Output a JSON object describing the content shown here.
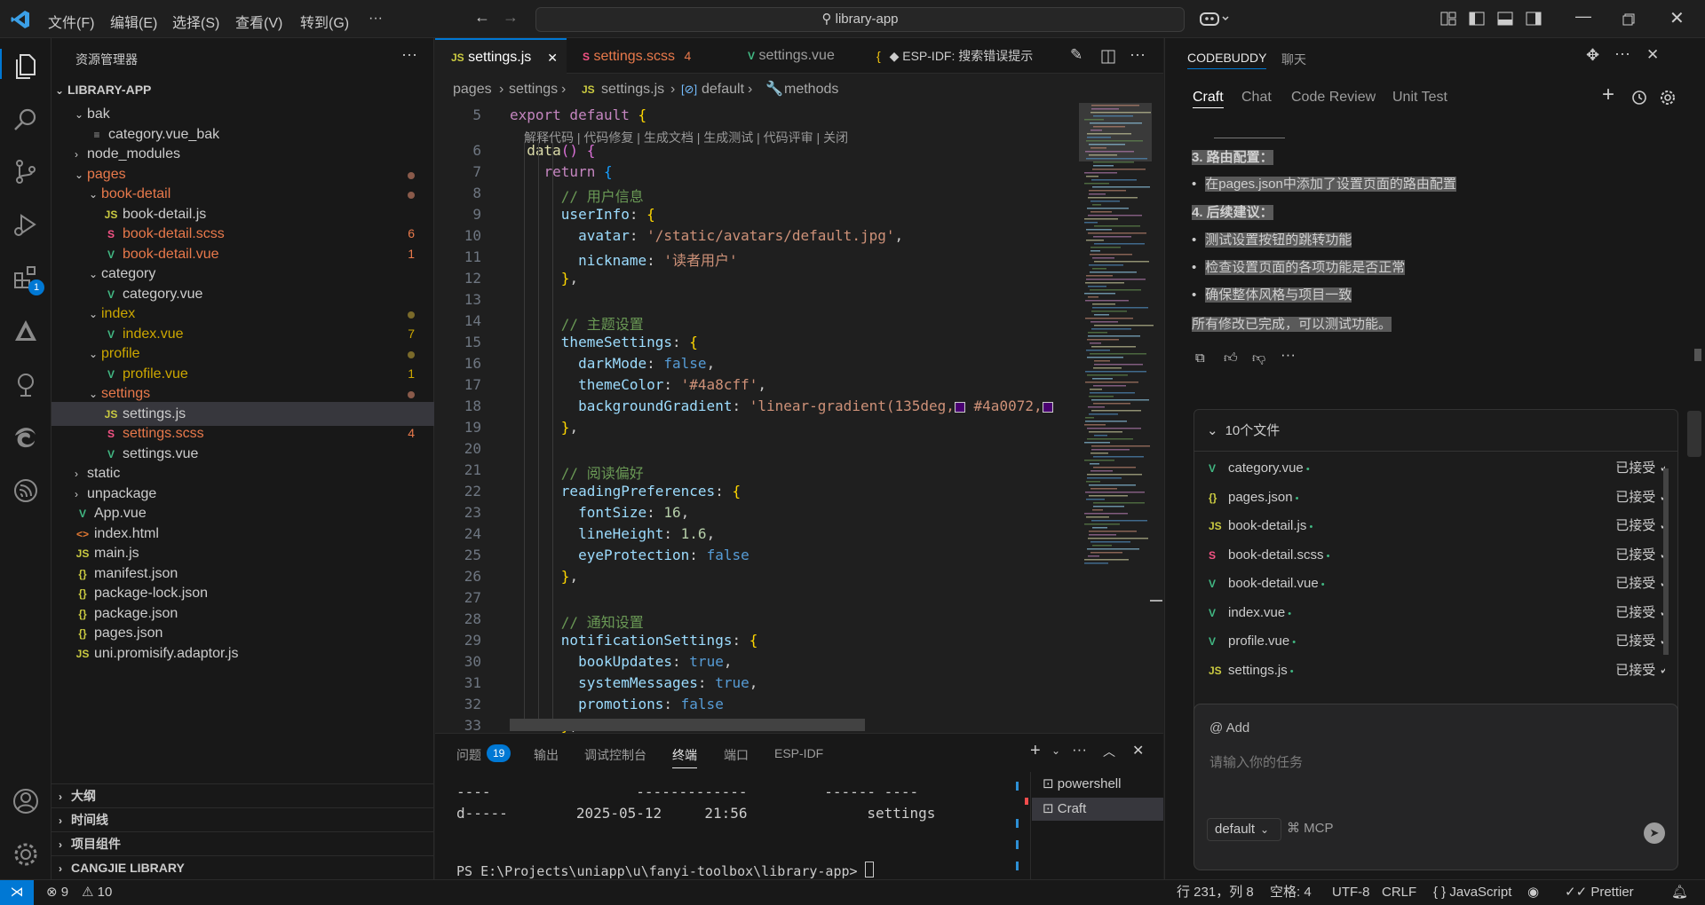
{
  "menu": [
    "文件(F)",
    "编辑(E)",
    "选择(S)",
    "查看(V)",
    "转到(G)",
    "···"
  ],
  "search": {
    "text": "library-app"
  },
  "activity": {
    "extensions_badge": "1"
  },
  "explorer": {
    "title": "资源管理器",
    "root": "LIBRARY-APP",
    "rows": [
      {
        "label": "bak",
        "type": "folder",
        "open": true,
        "depth": 1
      },
      {
        "label": "category.vue_bak",
        "type": "bak",
        "depth": 2
      },
      {
        "label": "node_modules",
        "type": "folder",
        "open": false,
        "depth": 1
      },
      {
        "label": "pages",
        "type": "folder",
        "open": true,
        "depth": 1,
        "color": "#e8794b",
        "dot": "#8a5a4a"
      },
      {
        "label": "book-detail",
        "type": "folder",
        "open": true,
        "depth": 2,
        "color": "#e8794b",
        "dot": "#8a5a4a"
      },
      {
        "label": "book-detail.js",
        "type": "js",
        "depth": 3
      },
      {
        "label": "book-detail.scss",
        "type": "scss",
        "depth": 3,
        "color": "#e8794b",
        "badge": "6"
      },
      {
        "label": "book-detail.vue",
        "type": "vue",
        "depth": 3,
        "color": "#e8794b",
        "badge": "1"
      },
      {
        "label": "category",
        "type": "folder",
        "open": true,
        "depth": 2
      },
      {
        "label": "category.vue",
        "type": "vue",
        "depth": 3
      },
      {
        "label": "index",
        "type": "folder",
        "open": true,
        "depth": 2,
        "color": "#cca700",
        "dot": "#7a6a2a"
      },
      {
        "label": "index.vue",
        "type": "vue",
        "depth": 3,
        "color": "#cca700",
        "badge": "7"
      },
      {
        "label": "profile",
        "type": "folder",
        "open": true,
        "depth": 2,
        "color": "#cca700",
        "dot": "#7a6a2a"
      },
      {
        "label": "profile.vue",
        "type": "vue",
        "depth": 3,
        "color": "#cca700",
        "badge": "1"
      },
      {
        "label": "settings",
        "type": "folder",
        "open": true,
        "depth": 2,
        "color": "#e8794b",
        "dot": "#8a5a4a"
      },
      {
        "label": "settings.js",
        "type": "js",
        "depth": 3,
        "selected": true
      },
      {
        "label": "settings.scss",
        "type": "scss",
        "depth": 3,
        "color": "#e8794b",
        "badge": "4"
      },
      {
        "label": "settings.vue",
        "type": "vue",
        "depth": 3
      },
      {
        "label": "static",
        "type": "folder",
        "open": false,
        "depth": 1
      },
      {
        "label": "unpackage",
        "type": "folder",
        "open": false,
        "depth": 1
      },
      {
        "label": "App.vue",
        "type": "vue",
        "depth": 1
      },
      {
        "label": "index.html",
        "type": "html",
        "depth": 1
      },
      {
        "label": "main.js",
        "type": "js",
        "depth": 1
      },
      {
        "label": "manifest.json",
        "type": "json",
        "depth": 1
      },
      {
        "label": "package-lock.json",
        "type": "json",
        "depth": 1
      },
      {
        "label": "package.json",
        "type": "json",
        "depth": 1
      },
      {
        "label": "pages.json",
        "type": "json",
        "depth": 1
      },
      {
        "label": "uni.promisify.adaptor.js",
        "type": "js",
        "depth": 1
      }
    ],
    "sections": [
      "大纲",
      "时间线",
      "项目组件",
      "CANGJIE LIBRARY"
    ]
  },
  "icons": {
    "js": "JS",
    "vue": "V",
    "json": "{}",
    "html": "<>",
    "scss": "S",
    "bak": "≡"
  },
  "tabs": [
    {
      "label": "settings.js",
      "icon": "JS",
      "active": true
    },
    {
      "label": "settings.scss",
      "badge": "4",
      "icon": "S"
    },
    {
      "label": "settings.vue",
      "icon": "V"
    }
  ],
  "esp": {
    "label": "ESP-IDF:  搜索错误提示"
  },
  "breadcrumb": [
    "pages",
    "settings",
    "settings.js",
    "default",
    "methods"
  ],
  "codelens": "解释代码 | 代码修复 | 生成文档 | 生成测试 | 代码评审 | 关闭",
  "code": [
    {
      "n": "5",
      "html": "<span class='kw'>export default</span> <span class='br'>{</span>"
    },
    {
      "n": "6",
      "html": "  <span class='fn'>data</span><span class='br2'>()</span> <span class='br2'>{</span>"
    },
    {
      "n": "7",
      "html": "    <span class='kw'>return</span> <span class='br3'>{</span>"
    },
    {
      "n": "8",
      "html": "      <span class='cm'>// 用户信息</span>"
    },
    {
      "n": "9",
      "html": "      <span class='pr'>userInfo</span>: <span class='br'>{</span>"
    },
    {
      "n": "10",
      "html": "        <span class='pr'>avatar</span>: <span class='st'>'/static/avatars/default.jpg'</span>,"
    },
    {
      "n": "11",
      "html": "        <span class='pr'>nickname</span>: <span class='st'>'读者用户'</span>"
    },
    {
      "n": "12",
      "html": "      <span class='br'>}</span>,"
    },
    {
      "n": "13",
      "html": ""
    },
    {
      "n": "14",
      "html": "      <span class='cm'>// 主题设置</span>"
    },
    {
      "n": "15",
      "html": "      <span class='pr'>themeSettings</span>: <span class='br'>{</span>"
    },
    {
      "n": "16",
      "html": "        <span class='pr'>darkMode</span>: <span class='bo'>false</span>,"
    },
    {
      "n": "17",
      "html": "        <span class='pr'>themeColor</span>: <span class='st'>'#4a8cff'</span>,"
    },
    {
      "n": "18",
      "html": "        <span class='pr'>backgroundGradient</span>: <span class='st'>'linear-gradient(135deg,<span style=\"display:inline-block;width:12px;height:12px;border:1px solid #ccc;background:#4a0072;vertical-align:middle\"></span> #4a0072,<span style=\"display:inline-block;width:12px;height:12px;border:1px solid #ccc;background:#4a0072;vertical-align:middle\"></span></span>"
    },
    {
      "n": "19",
      "html": "      <span class='br'>}</span>,"
    },
    {
      "n": "20",
      "html": ""
    },
    {
      "n": "21",
      "html": "      <span class='cm'>// 阅读偏好</span>"
    },
    {
      "n": "22",
      "html": "      <span class='pr'>readingPreferences</span>: <span class='br'>{</span>"
    },
    {
      "n": "23",
      "html": "        <span class='pr'>fontSize</span>: <span class='nu'>16</span>,"
    },
    {
      "n": "24",
      "html": "        <span class='pr'>lineHeight</span>: <span class='nu'>1.6</span>,"
    },
    {
      "n": "25",
      "html": "        <span class='pr'>eyeProtection</span>: <span class='bo'>false</span>"
    },
    {
      "n": "26",
      "html": "      <span class='br'>}</span>,"
    },
    {
      "n": "27",
      "html": ""
    },
    {
      "n": "28",
      "html": "      <span class='cm'>// 通知设置</span>"
    },
    {
      "n": "29",
      "html": "      <span class='pr'>notificationSettings</span>: <span class='br'>{</span>"
    },
    {
      "n": "30",
      "html": "        <span class='pr'>bookUpdates</span>: <span class='bo'>true</span>,"
    },
    {
      "n": "31",
      "html": "        <span class='pr'>systemMessages</span>: <span class='bo'>true</span>,"
    },
    {
      "n": "32",
      "html": "        <span class='pr'>promotions</span>: <span class='bo'>false</span>"
    },
    {
      "n": "33",
      "html": "      <span class='br'>}</span>,"
    }
  ],
  "panel": {
    "tabs": [
      "问题",
      "输出",
      "调试控制台",
      "终端",
      "端口",
      "ESP-IDF"
    ],
    "problems_badge": "19",
    "terminal_lines": [
      "----                 -------------         ------ ----",
      "d-----        2025-05-12     21:56              settings",
      "",
      "",
      "PS E:\\Projects\\uniapp\\u\\fanyi-toolbox\\library-app> "
    ],
    "terminals": [
      "powershell",
      "Craft"
    ]
  },
  "right": {
    "header": [
      "CODEBUDDY",
      "聊天"
    ],
    "tabs": [
      "Craft",
      "Chat",
      "Code Review",
      "Unit Test"
    ],
    "chat": {
      "h3": "3. 路由配置：",
      "b3": "在pages.json中添加了设置页面的路由配置",
      "h4": "4. 后续建议：",
      "b4": [
        "测试设置按钮的跳转功能",
        "检查设置页面的各项功能是否正常",
        "确保整体风格与项目一致"
      ],
      "done": "所有修改已完成，可以测试功能。"
    },
    "files_title": "10个文件",
    "files": [
      {
        "name": "category.vue",
        "icon": "V",
        "status": "已接受"
      },
      {
        "name": "pages.json",
        "icon": "{}",
        "status": "已接受"
      },
      {
        "name": "book-detail.js",
        "icon": "JS",
        "status": "已接受"
      },
      {
        "name": "book-detail.scss",
        "icon": "S",
        "status": "已接受"
      },
      {
        "name": "book-detail.vue",
        "icon": "V",
        "status": "已接受"
      },
      {
        "name": "index.vue",
        "icon": "V",
        "status": "已接受"
      },
      {
        "name": "profile.vue",
        "icon": "V",
        "status": "已接受"
      },
      {
        "name": "settings.js",
        "icon": "JS",
        "status": "已接受"
      }
    ],
    "input": {
      "add": "@ Add",
      "placeholder": "请输入你的任务",
      "model": "default",
      "mcp": "MCP"
    }
  },
  "status": {
    "errors": "9",
    "warnings": "10",
    "position": "行 231，列 8",
    "spaces": "空格: 4",
    "encoding": "UTF-8",
    "eol": "CRLF",
    "language": "JavaScript",
    "prettier": "Prettier"
  }
}
